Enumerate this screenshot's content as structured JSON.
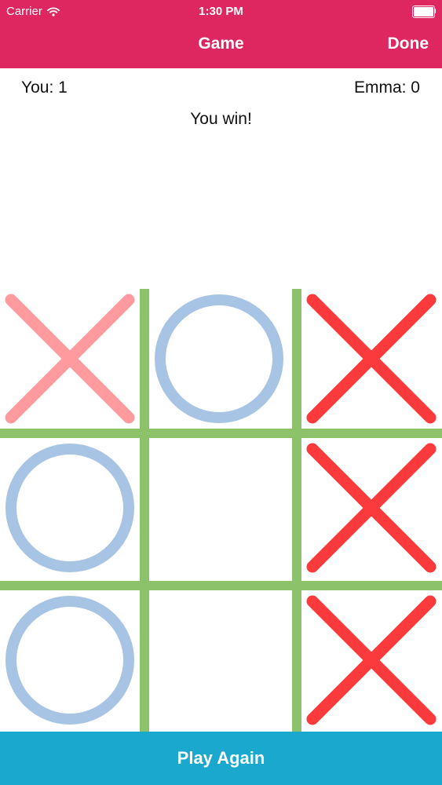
{
  "status_bar": {
    "carrier": "Carrier",
    "time": "1:30 PM",
    "icons": [
      "wifi-icon",
      "battery-icon"
    ]
  },
  "nav": {
    "title": "Game",
    "done_label": "Done",
    "background": "#de2760"
  },
  "scores": {
    "player_label": "You: 1",
    "opponent_label": "Emma: 0"
  },
  "result_text": "You win!",
  "board": {
    "grid_color": "#8cc36a",
    "cells": [
      {
        "mark": "X",
        "color": "#ff9a9e"
      },
      {
        "mark": "O",
        "color": "#a8c4e4"
      },
      {
        "mark": "X",
        "color": "#fb3b3b"
      },
      {
        "mark": "O",
        "color": "#a8c4e4"
      },
      {
        "mark": "",
        "color": ""
      },
      {
        "mark": "X",
        "color": "#fb3b3b"
      },
      {
        "mark": "O",
        "color": "#a8c4e4"
      },
      {
        "mark": "",
        "color": ""
      },
      {
        "mark": "X",
        "color": "#fb3b3b"
      }
    ]
  },
  "play_again_label": "Play Again",
  "play_again_color": "#1aa8cf"
}
